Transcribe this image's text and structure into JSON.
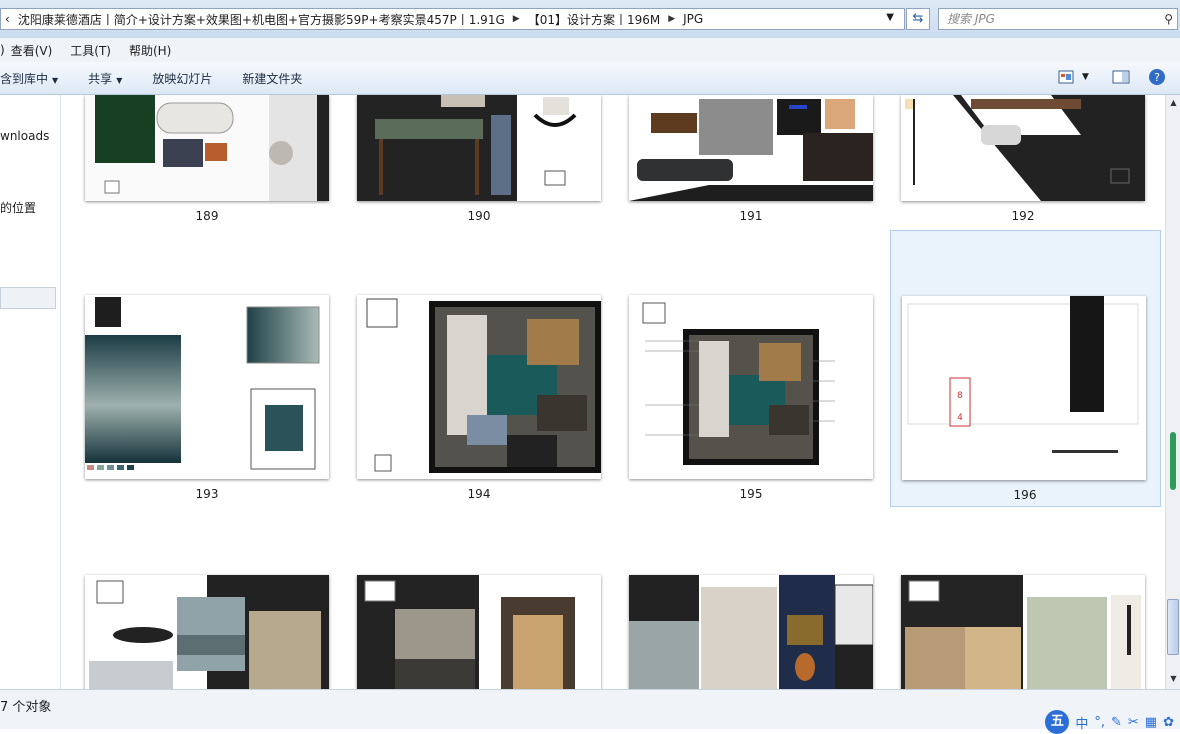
{
  "address": {
    "crumbs": [
      "沈阳康莱德酒店丨简介+设计方案+效果图+机电图+官方摄影59P+考察实景457P丨1.91G",
      "【01】设计方案丨196M",
      "JPG"
    ],
    "back_glyph": "‹"
  },
  "search": {
    "placeholder": "搜索 JPG"
  },
  "menubar": {
    "items": [
      "查看(V)",
      "工具(T)",
      "帮助(H)"
    ],
    "truncated_first": ")"
  },
  "toolbar": {
    "include_library": "含到库中",
    "share": "共享",
    "slideshow": "放映幻灯片",
    "new_folder": "新建文件夹"
  },
  "nav": {
    "item_downloads": "wnloads",
    "item_location": "的位置"
  },
  "files": [
    {
      "label": "189"
    },
    {
      "label": "190"
    },
    {
      "label": "191"
    },
    {
      "label": "192"
    },
    {
      "label": "193"
    },
    {
      "label": "194"
    },
    {
      "label": "195"
    },
    {
      "label": "196"
    }
  ],
  "status": {
    "count": "7 个对象"
  },
  "ime": {
    "main": "五",
    "items": [
      "中",
      "°,",
      "✎",
      "✂",
      "▦",
      "✿"
    ]
  },
  "colors": {
    "accent": "#2b6fd6",
    "selection": "#eaf2fb",
    "chrome": "#dde8f5"
  }
}
